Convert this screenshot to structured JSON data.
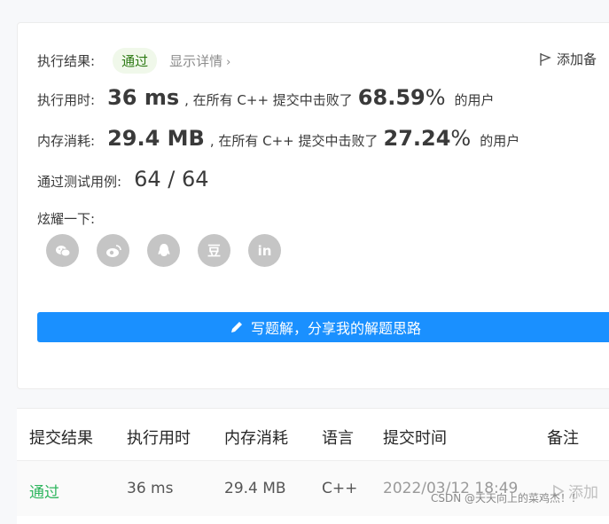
{
  "result": {
    "label": "执行结果:",
    "status": "通过",
    "detail_link": "显示详情",
    "note_link": "添加备"
  },
  "runtime": {
    "label": "执行用时:",
    "value": "36 ms",
    "middle": ", 在所有 C++ 提交中击败了",
    "percent": "68.59",
    "percent_sign": "%",
    "suffix": "的用户"
  },
  "memory": {
    "label": "内存消耗:",
    "value": "29.4 MB",
    "middle": ", 在所有 C++ 提交中击败了",
    "percent": "27.24",
    "percent_sign": "%",
    "suffix": "的用户"
  },
  "testcases": {
    "label": "通过测试用例:",
    "value": "64 / 64"
  },
  "share": {
    "label": "炫耀一下:",
    "icons": [
      "wechat-icon",
      "weibo-icon",
      "qq-icon",
      "douban-icon",
      "linkedin-icon"
    ],
    "douban_glyph": "豆",
    "linkedin_glyph": "in"
  },
  "solution_button": {
    "label": "写题解，分享我的解题思路"
  },
  "table": {
    "headers": [
      "提交结果",
      "执行用时",
      "内存消耗",
      "语言",
      "提交时间",
      "备注"
    ],
    "rows": [
      {
        "status": "通过",
        "runtime": "36 ms",
        "memory": "29.4 MB",
        "language": "C++",
        "time": "2022/03/12 18:49",
        "note": "添加"
      }
    ]
  },
  "watermark": "CSDN @天天向上的菜鸡杰！！",
  "colors": {
    "accent": "#1a90ff",
    "success": "#2db55d",
    "badge_bg": "#f0f8ea"
  }
}
